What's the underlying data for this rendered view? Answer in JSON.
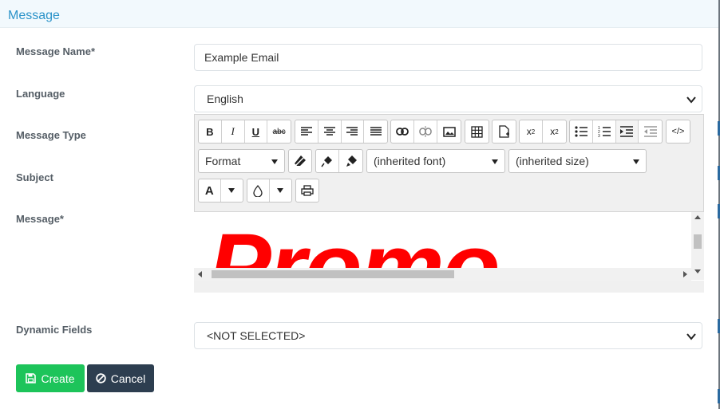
{
  "modal": {
    "title": "Message"
  },
  "form": {
    "message_name_label": "Message Name*",
    "message_name_value": "Example Email",
    "language_label": "Language",
    "language_value": "English",
    "message_type_label": "Message Type",
    "subject_label": "Subject",
    "message_label": "Message*",
    "dynamic_fields_label": "Dynamic Fields",
    "dynamic_fields_value": "<NOT SELECTED>"
  },
  "editor": {
    "format_label": "Format",
    "font_label": "(inherited font)",
    "size_label": "(inherited size)",
    "bold": "B",
    "italic": "I",
    "underline": "U",
    "strike": "abc",
    "font_color": "A",
    "content_text": "Promo",
    "content_color": "#ff0000"
  },
  "buttons": {
    "create": "Create",
    "cancel": "Cancel"
  },
  "colors": {
    "accent": "#2b93c9",
    "create": "#1dc45a",
    "cancel": "#2d3e50"
  }
}
